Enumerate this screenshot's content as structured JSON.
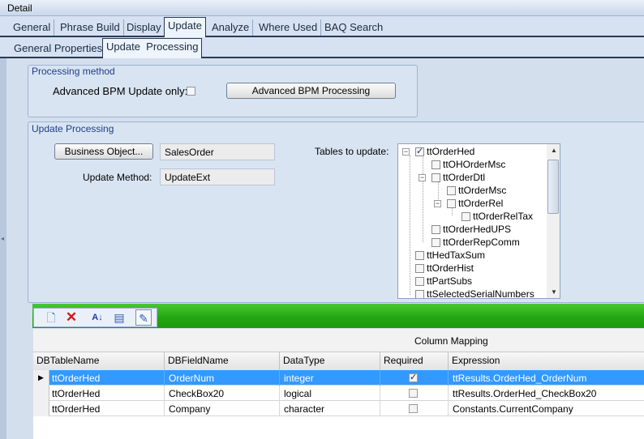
{
  "window": {
    "title": "Detail"
  },
  "tabs_primary": [
    "General",
    "Phrase Build",
    "Display",
    "Update",
    "Analyze",
    "Where Used",
    "BAQ Search"
  ],
  "tabs_primary_selected": "Update",
  "tabs_secondary": [
    "General Properties",
    "Update  Processing"
  ],
  "tabs_secondary_selected": "Update  Processing",
  "processing_method": {
    "group_title": "Processing method",
    "advanced_only_label": "Advanced BPM Update only:",
    "advanced_only_checked": false,
    "advanced_button": "Advanced BPM Processing"
  },
  "update_processing": {
    "group_title": "Update Processing",
    "business_object_button": "Business Object...",
    "business_object_value": "SalesOrder",
    "update_method_label": "Update Method:",
    "update_method_value": "UpdateExt",
    "tables_label": "Tables to update:",
    "tables": [
      {
        "name": "ttOrderHed",
        "checked": true
      },
      {
        "name": "ttOHOrderMsc",
        "checked": false
      },
      {
        "name": "ttOrderDtl",
        "checked": false
      },
      {
        "name": "ttOrderMsc",
        "checked": false
      },
      {
        "name": "ttOrderRel",
        "checked": false
      },
      {
        "name": "ttOrderRelTax",
        "checked": false
      },
      {
        "name": "ttOrderHedUPS",
        "checked": false
      },
      {
        "name": "ttOrderRepComm",
        "checked": false
      },
      {
        "name": "ttHedTaxSum",
        "checked": false
      },
      {
        "name": "ttOrderHist",
        "checked": false
      },
      {
        "name": "ttPartSubs",
        "checked": false
      },
      {
        "name": "ttSelectedSerialNumbers",
        "checked": false
      }
    ]
  },
  "toolbar": {
    "icons": [
      "new-icon",
      "delete-icon",
      "sort-icon",
      "properties-icon",
      "edit-icon"
    ]
  },
  "grid": {
    "band_header": "Column Mapping",
    "columns": [
      "DBTableName",
      "DBFieldName",
      "DataType",
      "Required",
      "Expression"
    ],
    "rows": [
      {
        "table": "ttOrderHed",
        "field": "OrderNum",
        "type": "integer",
        "required": true,
        "expression": "ttResults.OrderHed_OrderNum",
        "selected": true
      },
      {
        "table": "ttOrderHed",
        "field": "CheckBox20",
        "type": "logical",
        "required": false,
        "expression": "ttResults.OrderHed_CheckBox20",
        "selected": false
      },
      {
        "table": "ttOrderHed",
        "field": "Company",
        "type": "character",
        "required": false,
        "expression": "Constants.CurrentCompany",
        "selected": false
      }
    ]
  },
  "colors": {
    "selection": "#3399ff",
    "toolbar_green": "#23a512",
    "group_title": "#1d3f8a"
  }
}
